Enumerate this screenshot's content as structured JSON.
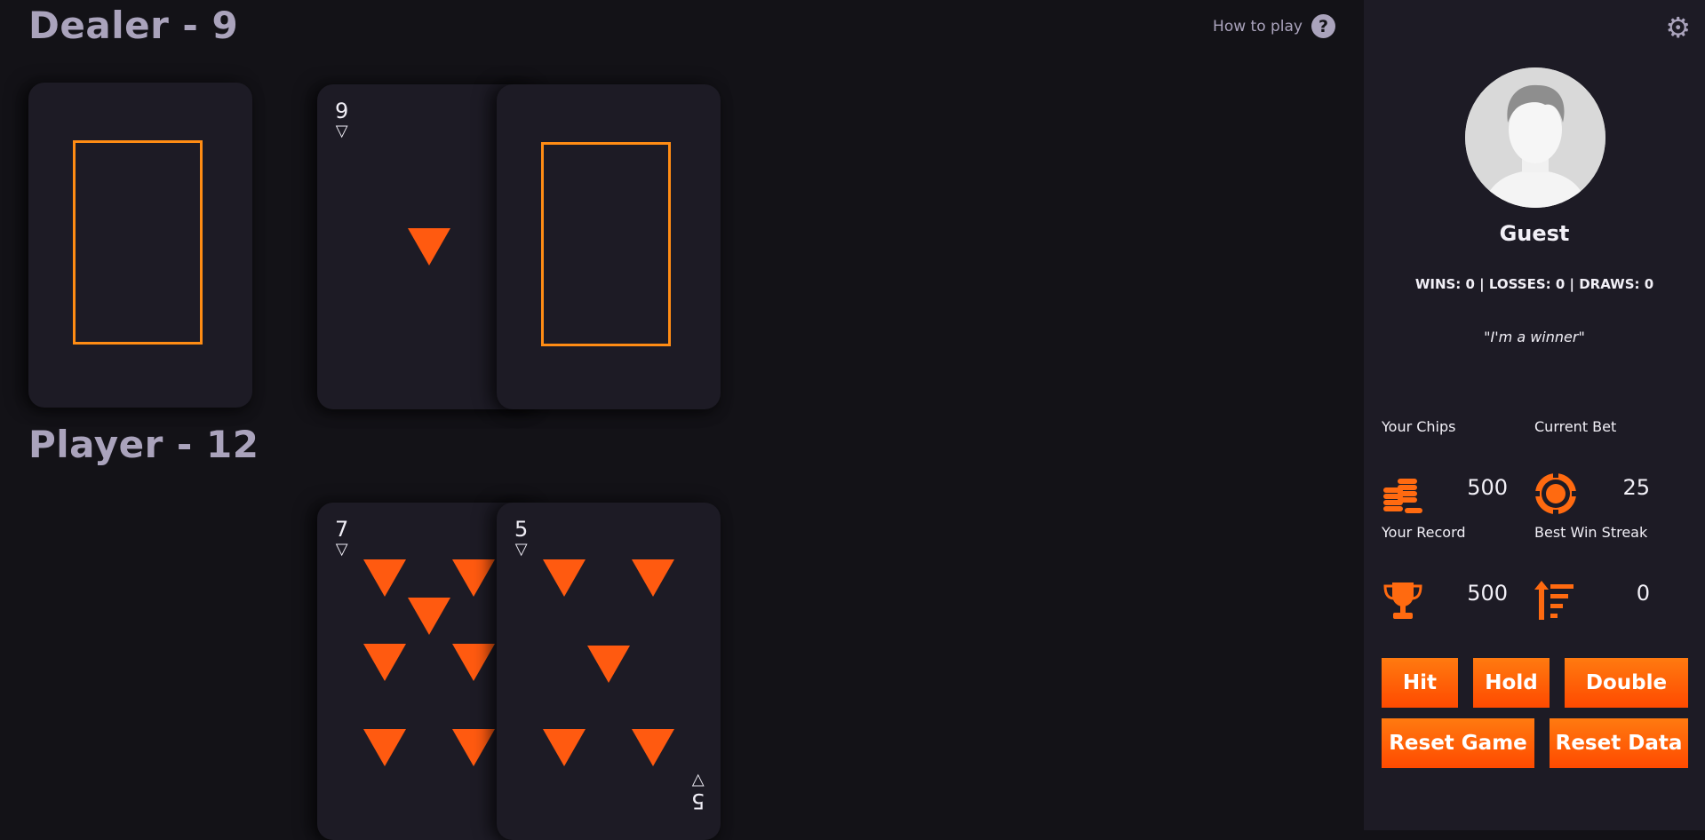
{
  "dealer": {
    "title": "Dealer - 9",
    "cards": [
      {
        "face_down": true
      },
      {
        "face_down": false,
        "rank": "9",
        "suit": "▽"
      },
      {
        "face_down": true
      }
    ]
  },
  "player": {
    "title": "Player - 12",
    "cards": [
      {
        "face_down": false,
        "rank": "7",
        "suit": "▽"
      },
      {
        "face_down": false,
        "rank": "5",
        "suit": "▽"
      }
    ]
  },
  "how_to_play": {
    "label": "How to play",
    "icon": "question-circle-icon"
  },
  "settings": {
    "icon": "gear-icon"
  },
  "profile": {
    "name": "Guest",
    "record": "WINS: 0 | LOSSES: 0 | DRAWS: 0",
    "quote": "\"I'm a winner\""
  },
  "stats": {
    "chips_label": "Your Chips",
    "chips_value": "500",
    "bet_label": "Current Bet",
    "bet_value": "25",
    "record_label": "Your Record",
    "record_value": "500",
    "streak_label": "Best Win Streak",
    "streak_value": "0"
  },
  "buttons": {
    "hit": "Hit",
    "hold": "Hold",
    "double": "Double",
    "reset_game": "Reset Game",
    "reset_data": "Reset Data"
  },
  "colors": {
    "background": "#131217",
    "sidebar": "#1d1b25",
    "card": "#1d1b25",
    "accent": "#ff5a10",
    "card_back_frame": "#ff8c14",
    "title": "#aaa3bc"
  }
}
